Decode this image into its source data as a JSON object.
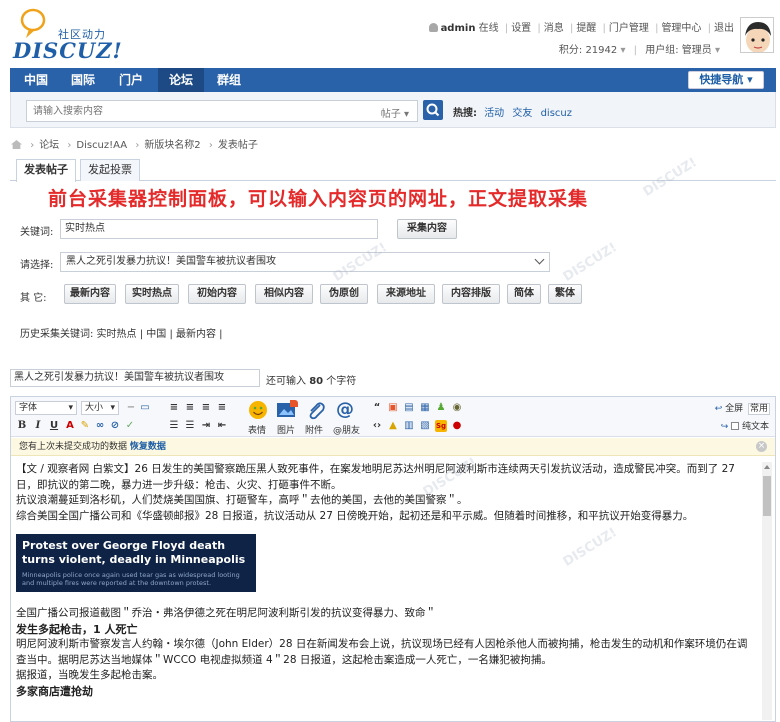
{
  "header": {
    "logo_cn": "社区动力",
    "logo_en": "DISCUZ!",
    "user": "admin",
    "status": "在线",
    "links": [
      "设置",
      "消息",
      "提醒",
      "门户管理",
      "管理中心",
      "退出"
    ],
    "points": "积分: 21942",
    "group": "用户组: 管理员"
  },
  "nav": {
    "items": [
      "中国",
      "国际",
      "门户",
      "论坛",
      "群组"
    ],
    "active": "论坛",
    "quick_nav": "快捷导航"
  },
  "search": {
    "placeholder": "请输入搜索内容",
    "type": "帖子",
    "hot_label": "热搜:",
    "hot_terms": [
      "活动",
      "交友",
      "discuz"
    ]
  },
  "breadcrumb": [
    "论坛",
    "Discuz!AA",
    "新版块名称2",
    "发表帖子"
  ],
  "tabs": [
    "发表帖子",
    "发起投票"
  ],
  "collector": {
    "title": "前台采集器控制面板，可以输入内容页的网址，正文提取采集",
    "keyword_label": "关键词:",
    "keyword_value": "实时热点",
    "collect_button": "采集内容",
    "choose_label": "请选择:",
    "choose_value": "黑人之死引发暴力抗议！美国警车被抗议者围攻",
    "other_label": "其  它:",
    "buttons": [
      "最新内容",
      "实时热点",
      "初始内容",
      "相似内容",
      "伪原创",
      "来源地址",
      "内容排版",
      "简体",
      "繁体"
    ],
    "history": "历史采集关键词: 实时热点 | 中国 | 最新内容 |"
  },
  "post": {
    "title_value": "黑人之死引发暴力抗议！美国警车被抗议者围攻",
    "title_hint_pre": "还可输入",
    "title_hint_num": "80",
    "title_hint_post": "个字符"
  },
  "editor": {
    "font_select": "字体",
    "size_select": "大小",
    "big_labels": [
      "表情",
      "图片",
      "附件",
      "@朋友"
    ],
    "full_label": "全屏",
    "common_label": "常用",
    "plain_label": "纯文本",
    "notice_text": "您有上次未提交成功的数据",
    "notice_link": "恢复数据",
    "paragraphs": [
      "【文 / 观察者网 白紫文】26 日发生的美国警察跪压黑人致死事件，在案发地明尼苏达州明尼阿波利斯市连续两天引发抗议活动，造成警民冲突。而到了 27 日，即抗议的第二晚，暴力进一步升级：枪击、火灾、打砸事件不断。",
      "抗议浪潮蔓延到洛杉矶，人们焚烧美国国旗、打砸警车，高呼＂去他的美国，去他的美国警察＂。",
      "综合美国全国广播公司和《华盛顿邮报》28 日报道，抗议活动从 27 日傍晚开始，起初还是和平示威。但随着时间推移，和平抗议开始变得暴力。"
    ],
    "image_headline": "Protest over George Floyd death turns violent, deadly in Minneapolis",
    "image_caption": "Minneapolis police once again used tear gas as widespread looting and multiple fires were reported at the downtown protest.",
    "caption_line": "全国广播公司报道截图＂乔治・弗洛伊德之死在明尼阿波利斯引发的抗议变得暴力、致命＂",
    "sub1": "发生多起枪击，1 人死亡",
    "para2": "明尼阿波利斯市警察发言人约翰・埃尔德（John Elder）28 日在新闻发布会上说，抗议现场已经有人因枪杀他人而被拘捕，枪击发生的动机和作案环境仍在调查当中。据明尼苏达当地媒体＂WCCO 电视虚拟频道 4＂28 日报道，这起枪击案造成一人死亡，一名嫌犯被拘捕。",
    "para3": "据报道，当晚发生多起枪击案。",
    "sub2": "多家商店遭抢劫"
  }
}
